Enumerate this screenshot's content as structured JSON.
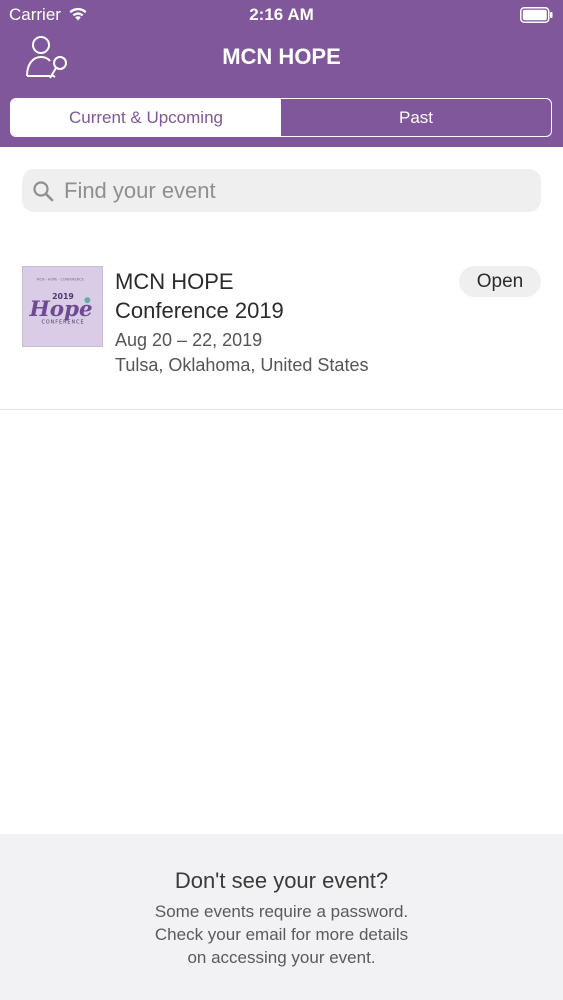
{
  "status_bar": {
    "carrier": "Carrier",
    "time": "2:16 AM"
  },
  "header": {
    "title": "MCN HOPE",
    "profile_icon": "user-key-icon",
    "background_color": "#80579a"
  },
  "tabs": [
    {
      "label": "Current & Upcoming",
      "selected": true
    },
    {
      "label": "Past",
      "selected": false
    }
  ],
  "search": {
    "placeholder": "Find your event",
    "value": ""
  },
  "events": [
    {
      "name_line1": "MCN HOPE",
      "name_line2": "Conference 2019",
      "dates": "Aug 20 – 22, 2019",
      "location": "Tulsa, Oklahoma, United States",
      "status": "Open",
      "logo": {
        "year": "2019",
        "word": "Hope",
        "subtitle": "CONFERENCE"
      }
    }
  ],
  "footer": {
    "title": "Don't see your event?",
    "line1": "Some events require a password.",
    "line2": "Check your email for more details",
    "line3": "on accessing your event."
  }
}
